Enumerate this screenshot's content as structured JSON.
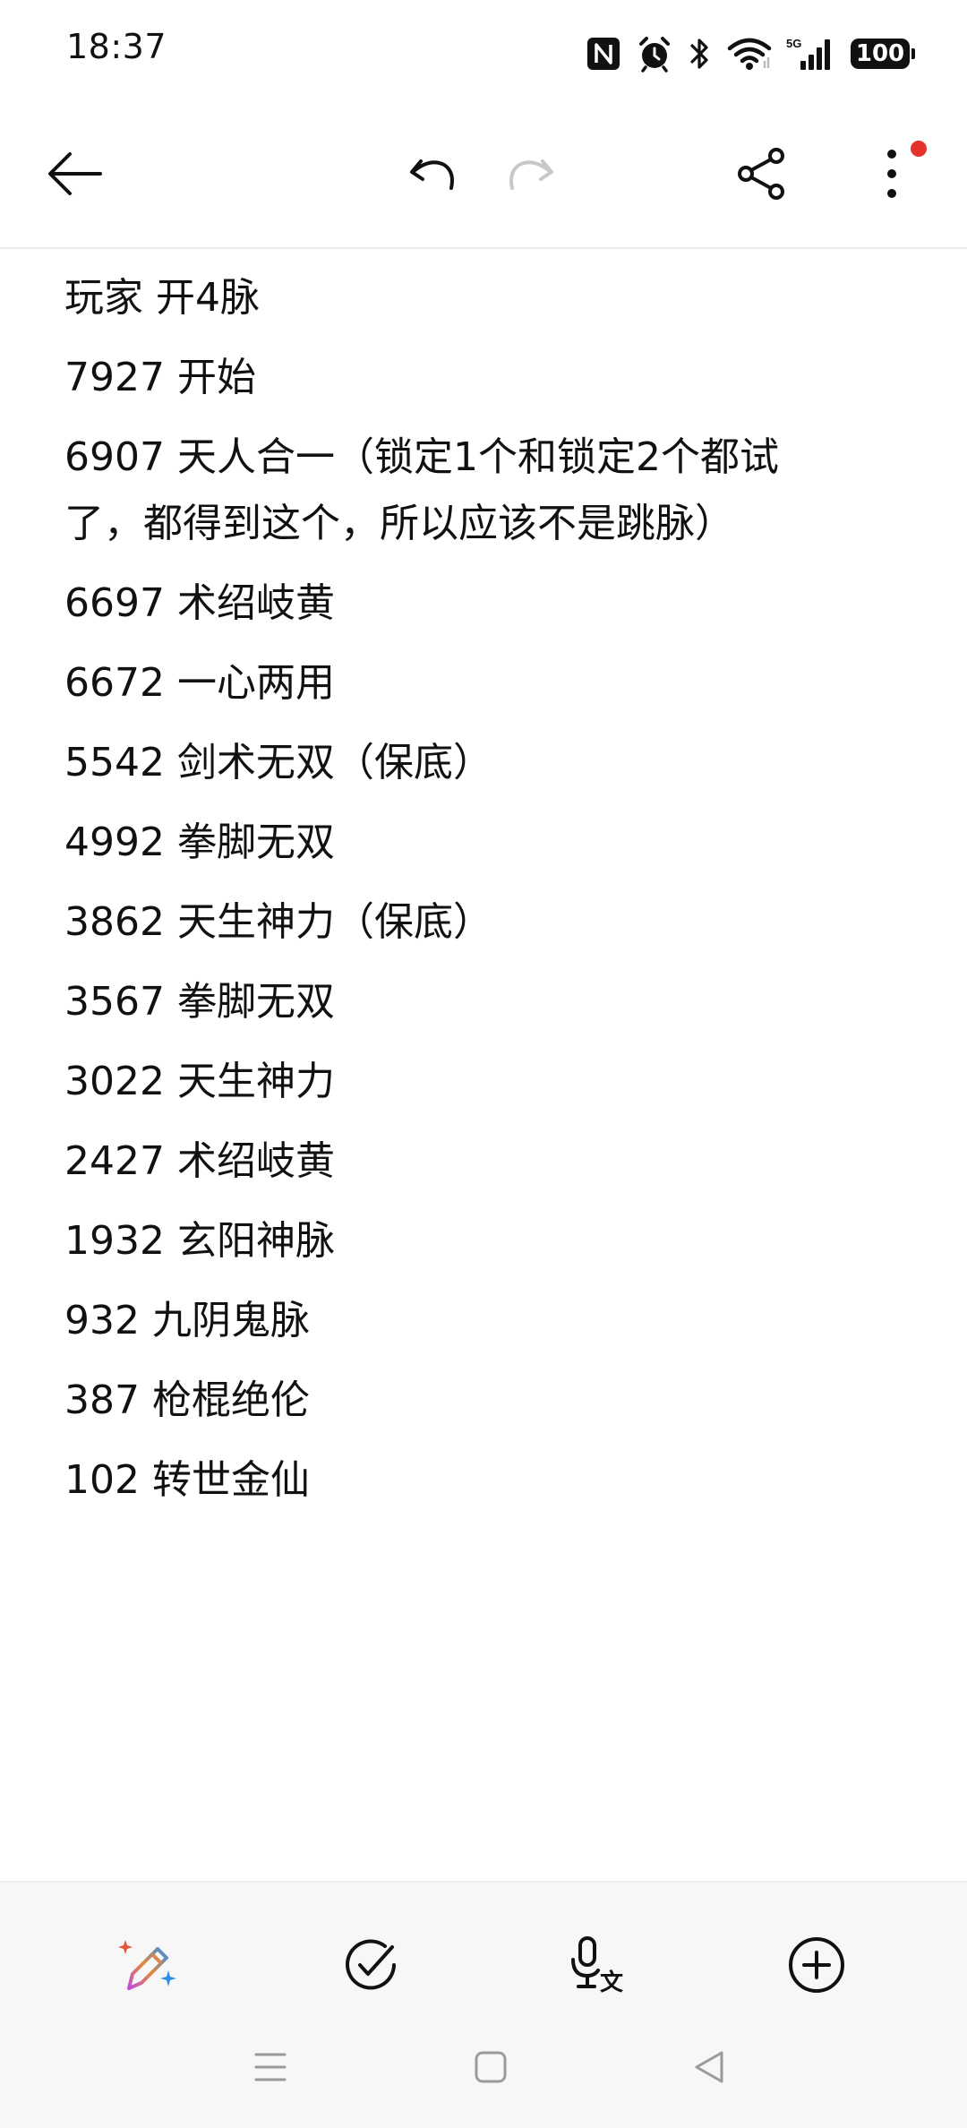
{
  "status_bar": {
    "time": "18:37",
    "icons": [
      "nfc-icon",
      "alarm-icon",
      "bluetooth-icon",
      "wifi-icon",
      "5g-signal-icon",
      "battery-icon"
    ],
    "network_label": "5G",
    "battery_level": "100"
  },
  "toolbar": {
    "icons": [
      "back-arrow-icon",
      "undo-icon",
      "redo-icon",
      "share-icon",
      "more-vert-icon"
    ],
    "redo_enabled": false,
    "notification_dot_color": "#e5322d"
  },
  "note": {
    "lines": [
      "玩家 开4脉",
      "7927 开始",
      "6907 天人合一（锁定1个和锁定2个都试了，都得到这个，所以应该不是跳脉）",
      "6697 术绍岐黄",
      "6672 一心两用",
      "5542 剑术无双（保底）",
      "4992 拳脚无双",
      "3862 天生神力（保底）",
      "3567 拳脚无双",
      "3022 天生神力",
      "2427 术绍岐黄",
      "1932 玄阳神脉",
      "932 九阴鬼脉",
      "387 枪棍绝伦",
      "102 转世金仙"
    ]
  },
  "bottom_tools": {
    "icons": [
      "ai-pen-icon",
      "checklist-icon",
      "voice-to-text-icon",
      "add-circle-icon"
    ],
    "voice_text_glyph": "文"
  },
  "nav_bar": {
    "icons": [
      "menu-icon",
      "home-square-icon",
      "back-triangle-icon"
    ]
  },
  "colors": {
    "text": "#111111",
    "disabled": "#c8c8c8",
    "accent_dot": "#e5322d",
    "bottom_bar_bg": "#f7f7f7"
  }
}
